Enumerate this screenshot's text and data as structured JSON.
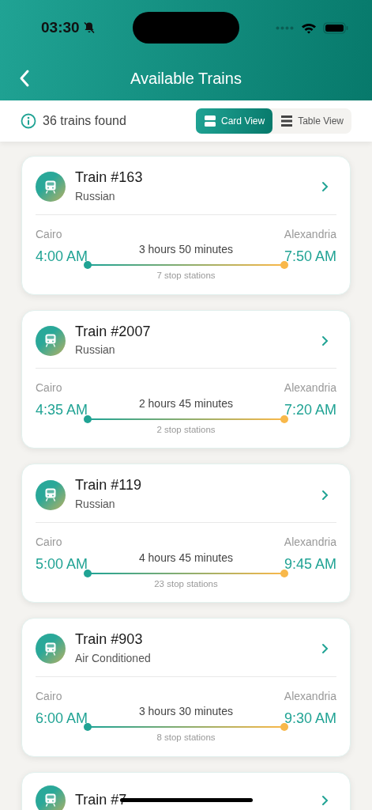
{
  "status_bar": {
    "time": "03:30"
  },
  "header": {
    "title": "Available Trains"
  },
  "toolbar": {
    "summary": "36 trains found",
    "views": [
      {
        "label": "Card View",
        "kind": "card",
        "selected": true
      },
      {
        "label": "Table View",
        "kind": "table",
        "selected": false
      }
    ]
  },
  "trains": [
    {
      "title": "Train #163",
      "type": "Russian",
      "from": "Cairo",
      "to": "Alexandria",
      "depart": "4:00 AM",
      "arrive": "7:50 AM",
      "duration": "3 hours 50 minutes",
      "stops": "7 stop stations"
    },
    {
      "title": "Train #2007",
      "type": "Russian",
      "from": "Cairo",
      "to": "Alexandria",
      "depart": "4:35 AM",
      "arrive": "7:20 AM",
      "duration": "2 hours 45 minutes",
      "stops": "2 stop stations"
    },
    {
      "title": "Train #119",
      "type": "Russian",
      "from": "Cairo",
      "to": "Alexandria",
      "depart": "5:00 AM",
      "arrive": "9:45 AM",
      "duration": "4 hours 45 minutes",
      "stops": "23 stop stations"
    },
    {
      "title": "Train #903",
      "type": "Air Conditioned",
      "from": "Cairo",
      "to": "Alexandria",
      "depart": "6:00 AM",
      "arrive": "9:30 AM",
      "duration": "3 hours 30 minutes",
      "stops": "8 stop stations"
    },
    {
      "title": "Train #7"
    }
  ]
}
